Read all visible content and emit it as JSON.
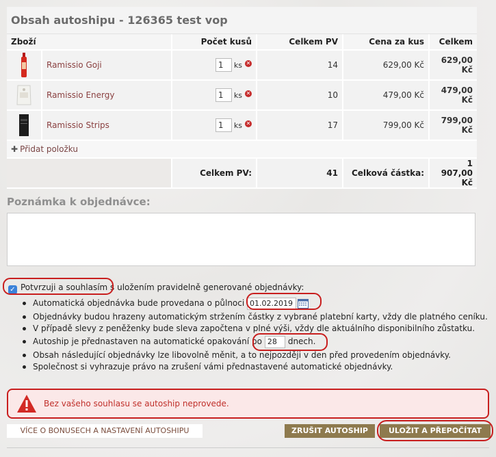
{
  "cart": {
    "title": "Obsah autoshipu - 126365 test vop",
    "headers": {
      "product": "Zboží",
      "qty": "Počet kusů",
      "pv": "Celkem PV",
      "unit_price": "Cena za kus",
      "total": "Celkem"
    },
    "items": [
      {
        "name": "Ramissio Goji",
        "qty": "1",
        "unit": "ks",
        "pv": "14",
        "unit_price": "629,00 Kč",
        "total": "629,00 Kč",
        "image_icon": "bottle-icon"
      },
      {
        "name": "Ramissio Energy",
        "qty": "1",
        "unit": "ks",
        "pv": "10",
        "unit_price": "479,00 Kč",
        "total": "479,00 Kč",
        "image_icon": "pouch-icon"
      },
      {
        "name": "Ramissio Strips",
        "qty": "1",
        "unit": "ks",
        "pv": "17",
        "unit_price": "799,00 Kč",
        "total": "799,00 Kč",
        "image_icon": "box-icon"
      }
    ],
    "add_item": "Přidat položku",
    "summary": {
      "pv_label": "Celkem PV:",
      "pv_value": "41",
      "amount_label": "Celková částka:",
      "amount_value": "1 907,00 Kč"
    }
  },
  "note": {
    "title": "Poznámka k objednávce:",
    "value": ""
  },
  "consent": {
    "checked": true,
    "label": "Potvrzuji a souhlasím s uložením pravidelně generované objednávky:",
    "rules": {
      "r1_prefix": "Automatická objednávka bude provedana o půlnoci",
      "date": "01.02.2019",
      "r2": "Objednávky budou hrazeny automatickým stržením částky z vybrané platební karty, vždy dle platného ceníku.",
      "r3": "V případě slevy z peněženky bude sleva započtena v plné výši, vždy dle aktuálního disponibilního zůstatku.",
      "r4_prefix": "Autoship je přednastaven na automatické opakování po",
      "days": "28",
      "r4_suffix": "dnech.",
      "r5": "Obsah následující objednávky lze libovolně měnit, a to nejpozději v den před provedením objednávky.",
      "r6": "Společnost si vyhrazuje právo na zrušení vámi přednastavené automatické objednávky."
    }
  },
  "alert": {
    "text": "Bez vašeho souhlasu se autoship neprovede."
  },
  "buttons": {
    "more": "Více o bonusech a nastavení autoshipu",
    "cancel": "Zrušit autoship",
    "save": "Uložit a přepočítat"
  },
  "colors": {
    "accent": "#8e7a4e",
    "alert_red": "#c81e1e",
    "link": "#8a4040"
  }
}
